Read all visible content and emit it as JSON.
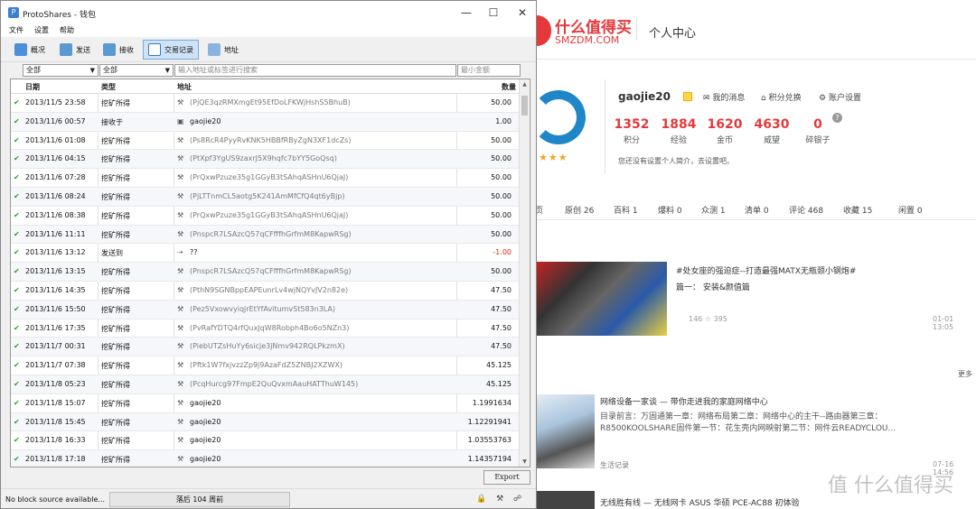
{
  "browser": {
    "logo_main": "什么值得买",
    "logo_sub": "SMZDM.COM",
    "page_title": "个人中心",
    "username": "gaojie20",
    "links": [
      "我的消息",
      "积分兑换",
      "账户设置"
    ],
    "stats": [
      {
        "value": "1352",
        "label": "积分"
      },
      {
        "value": "1884",
        "label": "经验"
      },
      {
        "value": "1620",
        "label": "金币"
      },
      {
        "value": "4630",
        "label": "威望"
      },
      {
        "value": "0",
        "label": "碎银子"
      }
    ],
    "signature": "您还没有设置个人简介，去设置吧。",
    "stars": "★★★",
    "help": "?",
    "tabs": [
      "页",
      "原创 26",
      "百科 1",
      "爆料 0",
      "众测 1",
      "清单 0",
      "评论 468",
      "收藏 15",
      "闲置 0"
    ],
    "post1": {
      "title": "#处女座的强迫症--打造最强MATX无瓶颈小钢炮#",
      "sub": "篇一： 安装&颜值篇",
      "meta": "146  ☆ 395",
      "date": "01-01 13:05"
    },
    "more": "更多",
    "post2": {
      "title": "网络设备一家谈 — 带你走进我的家庭网络中心",
      "preview": "目录前言：万固通第一章：网络布局第二章：网络中心的主干--路由器第三章：R8500KOOLSHARE固件第一节：花生壳内网映射第二节：网件云READYCLOU...",
      "category": "生活记录",
      "date": "07-16 14:56"
    },
    "post3": {
      "title": "无线胜有线 — 无线网卡 ASUS 华硕 PCE-AC88 初体验"
    },
    "watermark": "值 什么值得买"
  },
  "wallet": {
    "title": "ProtoShares - 钱包",
    "window_controls": [
      "—",
      "☐",
      "✕"
    ],
    "menu": [
      "文件",
      "设置",
      "帮助"
    ],
    "toolbar": [
      "概况",
      "发送",
      "接收",
      "交易记录",
      "地址"
    ],
    "filters": {
      "type1": "全部",
      "type2": "全部",
      "search_placeholder": "输入地址或标签进行搜索",
      "min_placeholder": "最小金额"
    },
    "columns": [
      "日期",
      "类型",
      "地址",
      "数量"
    ],
    "transactions": [
      {
        "date": "2013/11/5 23:58",
        "type": "挖矿所得",
        "address": "(PjQE3qzRMXmgEt95EfDoLFKWjHshS5BhuB)",
        "amount": "50.00"
      },
      {
        "date": "2013/11/6 00:57",
        "type": "接收于",
        "address": "gaojie20",
        "amount": "1.00"
      },
      {
        "date": "2013/11/6 01:08",
        "type": "挖矿所得",
        "address": "(Ps8RcR4PyyRvKNK5HBBfRByZgN3XF1dcZs)",
        "amount": "50.00"
      },
      {
        "date": "2013/11/6 04:15",
        "type": "挖矿所得",
        "address": "(PtXpf3YgUS9zaxrJ5X9hqfc7bYY5GoQsq)",
        "amount": "50.00"
      },
      {
        "date": "2013/11/6 07:28",
        "type": "挖矿所得",
        "address": "(PrQxwPzuze35g1GGyB3tSAhqASHnU6QjaJ)",
        "amount": "50.00"
      },
      {
        "date": "2013/11/6 08:24",
        "type": "挖矿所得",
        "address": "(PjLTTnmCL5aotg5K241AmMfCfQ4qt6yBjp)",
        "amount": "50.00"
      },
      {
        "date": "2013/11/6 08:38",
        "type": "挖矿所得",
        "address": "(PrQxwPzuze35g1GGyB3tSAhqASHnU6QjaJ)",
        "amount": "50.00"
      },
      {
        "date": "2013/11/6 11:11",
        "type": "挖矿所得",
        "address": "(PnspcR7LSAzcQ57qCFfffhGrfmM8KapwRSg)",
        "amount": "50.00"
      },
      {
        "date": "2013/11/6 13:12",
        "type": "发送到",
        "address": "??",
        "amount": "-1.00"
      },
      {
        "date": "2013/11/6 13:15",
        "type": "挖矿所得",
        "address": "(PnspcR7LSAzcQ57qCFfffhGrfmM8KapwRSg)",
        "amount": "50.00"
      },
      {
        "date": "2013/11/6 14:35",
        "type": "挖矿所得",
        "address": "(PthN9SGNBppEAPEunrLv4wjNQYvJV2n82e)",
        "amount": "47.50"
      },
      {
        "date": "2013/11/6 15:50",
        "type": "挖矿所得",
        "address": "(Pez5VxowvyiqjrEtYfAvitumvSt583n3LA)",
        "amount": "47.50"
      },
      {
        "date": "2013/11/6 17:35",
        "type": "挖矿所得",
        "address": "(PvRafYDTQ4rfQuxJqW8Robph4Bo6o5NZn3)",
        "amount": "47.50"
      },
      {
        "date": "2013/11/7 00:31",
        "type": "挖矿所得",
        "address": "(PiebUTZsHuYy6sicje3jNmv942RQLPkzmX)",
        "amount": "47.50"
      },
      {
        "date": "2013/11/7 07:38",
        "type": "挖矿所得",
        "address": "(Pftk1W7fxjvzzZp9j9AzaFdZ5ZNBJ2XZWX)",
        "amount": "45.125"
      },
      {
        "date": "2013/11/8 05:23",
        "type": "挖矿所得",
        "address": "(PcqHurcg97FmpE2QuQvxmAauHATThuW145)",
        "amount": "45.125"
      },
      {
        "date": "2013/11/8 15:07",
        "type": "挖矿所得",
        "address": "gaojie20",
        "amount": "1.1991634"
      },
      {
        "date": "2013/11/8 15:45",
        "type": "挖矿所得",
        "address": "gaojie20",
        "amount": "1.12291941"
      },
      {
        "date": "2013/11/8 16:33",
        "type": "挖矿所得",
        "address": "gaojie20",
        "amount": "1.03553763"
      },
      {
        "date": "2013/11/8 17:18",
        "type": "挖矿所得",
        "address": "gaojie20",
        "amount": "1.14357194"
      }
    ],
    "export_label": "Export",
    "status_message": "No block source available...",
    "sync_status": "落后 104 周前",
    "status_icons": "🔒 ⚒ ☍"
  }
}
